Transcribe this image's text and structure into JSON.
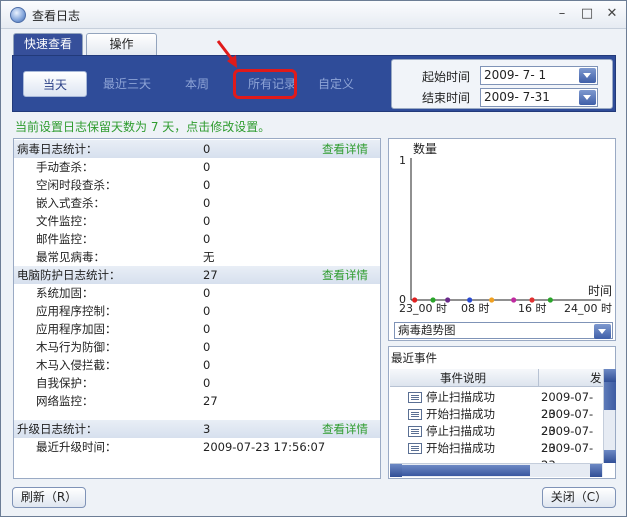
{
  "window": {
    "title": "查看日志",
    "controls": {
      "minimize": "–",
      "maximize": "□",
      "close": "✕"
    }
  },
  "tabs": [
    {
      "label": "快速查看",
      "active": true
    },
    {
      "label": "操作",
      "active": false
    }
  ],
  "quick_filters": [
    {
      "label": "当天",
      "active": true
    },
    {
      "label": "最近三天",
      "active": false
    },
    {
      "label": "本周",
      "active": false
    },
    {
      "label": "所有记录",
      "active": false,
      "highlighted": true
    },
    {
      "label": "自定义",
      "active": false
    }
  ],
  "date_range": {
    "start_label": "起始时间",
    "start_value": "2009-  7-  1",
    "end_label": "结束时间",
    "end_value": "2009-  7-31"
  },
  "notice": "当前设置日志保留天数为 7 天，点击修改设置。",
  "sections": [
    {
      "label": "病毒日志统计：",
      "value": "0",
      "link": "查看详情",
      "items": [
        {
          "label": "手动查杀：",
          "value": "0"
        },
        {
          "label": "空闲时段查杀：",
          "value": "0"
        },
        {
          "label": "嵌入式查杀：",
          "value": "0"
        },
        {
          "label": "文件监控：",
          "value": "0"
        },
        {
          "label": "邮件监控：",
          "value": "0"
        },
        {
          "label": "最常见病毒：",
          "value": "无"
        }
      ]
    },
    {
      "label": "电脑防护日志统计：",
      "value": "27",
      "link": "查看详情",
      "items": [
        {
          "label": "系统加固：",
          "value": "0"
        },
        {
          "label": "应用程序控制：",
          "value": "0"
        },
        {
          "label": "应用程序加固：",
          "value": "0"
        },
        {
          "label": "木马行为防御：",
          "value": "0"
        },
        {
          "label": "木马入侵拦截：",
          "value": "0"
        },
        {
          "label": "自我保护：",
          "value": "0"
        },
        {
          "label": "网络监控：",
          "value": "27"
        }
      ]
    },
    {
      "label": "升级日志统计：",
      "value": "3",
      "link": "查看详情",
      "items": [
        {
          "label": "最近升级时间：",
          "value": "2009-07-23 17:56:07"
        }
      ]
    }
  ],
  "chart": {
    "ylabel": "数量",
    "y_max_label": "1",
    "y_min_label": "0",
    "xlabel": "时间",
    "x_ticks": [
      "23_00 时",
      "08 时",
      "16 时",
      "24_00 时"
    ],
    "selector": "病毒趋势图"
  },
  "chart_data": {
    "type": "scatter",
    "title": "",
    "xlabel": "时间",
    "ylabel": "数量",
    "ylim": [
      0,
      1
    ],
    "x": [
      0.5,
      3.0,
      5.0,
      8.0,
      11.0,
      14.0,
      16.5,
      19.0
    ],
    "values": [
      0,
      0,
      0,
      0,
      0,
      0,
      0,
      0
    ],
    "x_tick_labels": [
      "23_00 时",
      "08 时",
      "16 时",
      "24_00 时"
    ],
    "colors": [
      "#e02020",
      "#2aa52a",
      "#6a2a8a",
      "#2a4ad0",
      "#f0a020",
      "#c02aa0",
      "#e03030",
      "#2aa52a"
    ]
  },
  "events": {
    "title": "最近事件",
    "columns": [
      "事件说明",
      "发"
    ],
    "rows": [
      {
        "desc": "停止扫描成功",
        "time": "2009-07-23"
      },
      {
        "desc": "开始扫描成功",
        "time": "2009-07-23"
      },
      {
        "desc": "停止扫描成功",
        "time": "2009-07-23"
      },
      {
        "desc": "开始扫描成功",
        "time": "2009-07-23"
      }
    ]
  },
  "buttons": {
    "refresh": "刷新（R）",
    "close": "关闭（C）"
  },
  "colors": {
    "toolbar_bg": "#2f4c99",
    "accent_green": "#2f9c2f",
    "highlight_red": "#e01a1a"
  }
}
